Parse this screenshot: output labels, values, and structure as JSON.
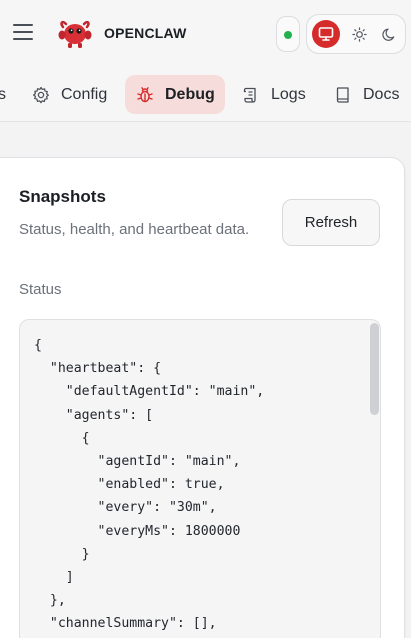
{
  "app": {
    "brand": "OPENCLAW"
  },
  "header": {
    "connection_status": "connected",
    "theme_options": [
      "system",
      "light",
      "dark"
    ],
    "theme_selected": "system"
  },
  "nav": {
    "tabs": [
      {
        "label": "s",
        "icon": "unknown-icon"
      },
      {
        "label": "Config",
        "icon": "gear-icon"
      },
      {
        "label": "Debug",
        "icon": "bug-icon",
        "active": true
      },
      {
        "label": "Logs",
        "icon": "scroll-icon"
      },
      {
        "label": "Docs",
        "icon": "book-icon"
      }
    ]
  },
  "snapshots": {
    "title": "Snapshots",
    "subtitle": "Status, health, and heartbeat data.",
    "refresh_label": "Refresh",
    "status_label": "Status",
    "status_json": "{\n  \"heartbeat\": {\n    \"defaultAgentId\": \"main\",\n    \"agents\": [\n      {\n        \"agentId\": \"main\",\n        \"enabled\": true,\n        \"every\": \"30m\",\n        \"everyMs\": 1800000\n      }\n    ]\n  },\n  \"channelSummary\": [],"
  },
  "colors": {
    "accent": "#d62b2b",
    "active_tab_bg": "#f7dcdc",
    "status_ok": "#22b14c"
  }
}
